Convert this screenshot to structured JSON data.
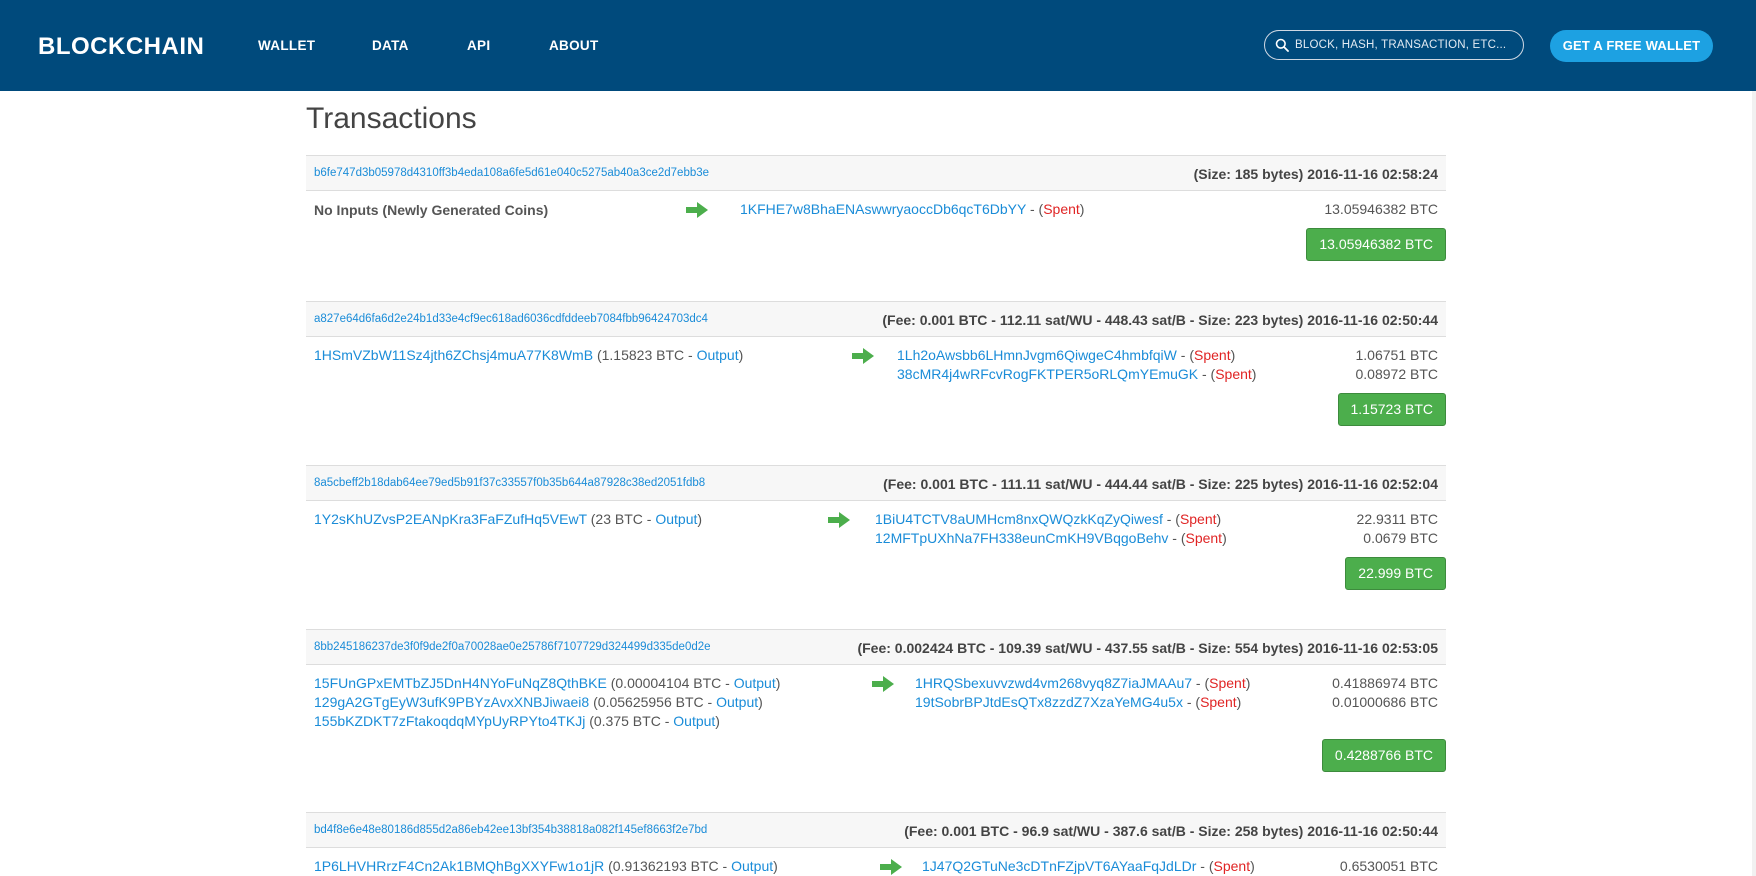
{
  "navbar": {
    "logo": "BLOCKCHAIN",
    "links": [
      "WALLET",
      "DATA",
      "API",
      "ABOUT"
    ],
    "search_placeholder": "BLOCK, HASH, TRANSACTION, ETC...",
    "cta": "GET A FREE WALLET"
  },
  "page": {
    "title": "Transactions"
  },
  "transactions": [
    {
      "hash": "b6fe747d3b05978d4310ff3b4eda108a6fe5d61e040c5275ab40a3ce2d7ebb3e",
      "meta": "(Size: 185 bytes) 2016-11-16 02:58:24",
      "inputs_text": "No Inputs (Newly Generated Coins)",
      "outputs": [
        {
          "address": "1KFHE7w8BhaENAswwryaoccDb6qcT6DbYY",
          "status": "Spent",
          "amount": "13.05946382 BTC"
        }
      ],
      "total": "13.05946382 BTC"
    },
    {
      "hash": "a827e64d6fa6d2e24b1d33e4cf9ec618ad6036cdfddeeb7084fbb96424703dc4",
      "meta": "(Fee: 0.001 BTC - 112.11 sat/WU - 448.43 sat/B - Size: 223 bytes) 2016-11-16 02:50:44",
      "inputs": [
        {
          "address": "1HSmVZbW11Sz4jth6ZChsj4muA77K8WmB",
          "amount": "1.15823 BTC",
          "link": "Output"
        }
      ],
      "outputs": [
        {
          "address": "1Lh2oAwsbb6LHmnJvgm6QiwgeC4hmbfqiW",
          "status": "Spent",
          "amount": "1.06751 BTC"
        },
        {
          "address": "38cMR4j4wRFcvRogFKTPER5oRLQmYEmuGK",
          "status": "Spent",
          "amount": "0.08972 BTC"
        }
      ],
      "total": "1.15723 BTC"
    },
    {
      "hash": "8a5cbeff2b18dab64ee79ed5b91f37c33557f0b35b644a87928c38ed2051fdb8",
      "meta": "(Fee: 0.001 BTC - 111.11 sat/WU - 444.44 sat/B - Size: 225 bytes) 2016-11-16 02:52:04",
      "inputs": [
        {
          "address": "1Y2sKhUZvsP2EANpKra3FaFZufHq5VEwT",
          "amount": "23 BTC",
          "link": "Output"
        }
      ],
      "outputs": [
        {
          "address": "1BiU4TCTV8aUMHcm8nxQWQzkKqZyQiwesf",
          "status": "Spent",
          "amount": "22.9311 BTC"
        },
        {
          "address": "12MFTpUXhNa7FH338eunCmKH9VBqgoBehv",
          "status": "Spent",
          "amount": "0.0679 BTC"
        }
      ],
      "total": "22.999 BTC"
    },
    {
      "hash": "8bb245186237de3f0f9de2f0a70028ae0e25786f7107729d324499d335de0d2e",
      "meta": "(Fee: 0.002424 BTC - 109.39 sat/WU - 437.55 sat/B - Size: 554 bytes) 2016-11-16 02:53:05",
      "inputs": [
        {
          "address": "15FUnGPxEMTbZJ5DnH4NYoFuNqZ8QthBKE",
          "amount": "0.00004104 BTC",
          "link": "Output"
        },
        {
          "address": "129gA2GTgEyW3ufK9PBYzAvxXNBJiwaei8",
          "amount": "0.05625956 BTC",
          "link": "Output"
        },
        {
          "address": "155bKZDKT7zFtakoqdqMYpUyRPYto4TKJj",
          "amount": "0.375 BTC",
          "link": "Output"
        }
      ],
      "outputs": [
        {
          "address": "1HRQSbexuvvzwd4vm268vyq8Z7iaJMAAu7",
          "status": "Spent",
          "amount": "0.41886974 BTC"
        },
        {
          "address": "19tSobrBPJtdEsQTx8zzdZ7XzaYeMG4u5x",
          "status": "Spent",
          "amount": "0.01000686 BTC"
        }
      ],
      "total": "0.4288766 BTC"
    },
    {
      "hash": "bd4f8e6e48e80186d855d2a86eb42ee13bf354b38818a082f145ef8663f2e7bd",
      "meta": "(Fee: 0.001 BTC - 96.9 sat/WU - 387.6 sat/B - Size: 258 bytes) 2016-11-16 02:50:44",
      "inputs": [
        {
          "address": "1P6LHVHRrzF4Cn2Ak1BMQhBgXXYFw1o1jR",
          "amount": "0.91362193 BTC",
          "link": "Output"
        }
      ],
      "outputs": [
        {
          "address": "1J47Q2GTuNe3cDTnFZjpVT6AYaaFqJdLDr",
          "status": "Spent",
          "amount": "0.6530051 BTC"
        }
      ]
    }
  ],
  "colors": {
    "navbar": "#004a7c",
    "accent": "#1da1e2",
    "link": "#1a8cd8",
    "spent": "#e02424",
    "total_button": "#4cae4c",
    "arrow": "#4cae4c"
  }
}
